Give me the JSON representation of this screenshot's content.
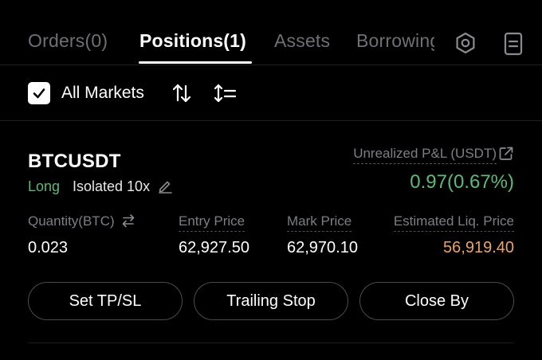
{
  "tabs": [
    {
      "label": "Orders(0)",
      "active": false
    },
    {
      "label": "Positions(1)",
      "active": true
    },
    {
      "label": "Assets",
      "active": false
    },
    {
      "label": "Borrowing",
      "active": false
    }
  ],
  "toolbar_icons": {
    "settings": "hexagon-settings-icon",
    "history": "document-icon"
  },
  "filter": {
    "all_markets_label": "All Markets",
    "all_markets_checked": true,
    "icons": [
      "sort-arrows-icon",
      "sort-list-icon"
    ]
  },
  "position": {
    "symbol": "BTCUSDT",
    "side": "Long",
    "margin_mode": "Isolated 10x",
    "pnl_label": "Unrealized P&L (USDT)",
    "pnl_value": "0.97(0.67%)",
    "columns": {
      "quantity": {
        "label": "Quantity(BTC)",
        "value": "0.023"
      },
      "entry_price": {
        "label": "Entry Price",
        "value": "62,927.50"
      },
      "mark_price": {
        "label": "Mark Price",
        "value": "62,970.10"
      },
      "liq_price": {
        "label": "Estimated Liq. Price",
        "value": "56,919.40"
      }
    },
    "actions": {
      "tpsl": "Set TP/SL",
      "trailing_stop": "Trailing Stop",
      "close_by": "Close By"
    }
  },
  "colors": {
    "background": "#000000",
    "profit_green": "#5fb87a",
    "liq_orange": "#e9a56a",
    "muted_text": "#7d7e84",
    "tab_inactive": "#6f7076"
  }
}
